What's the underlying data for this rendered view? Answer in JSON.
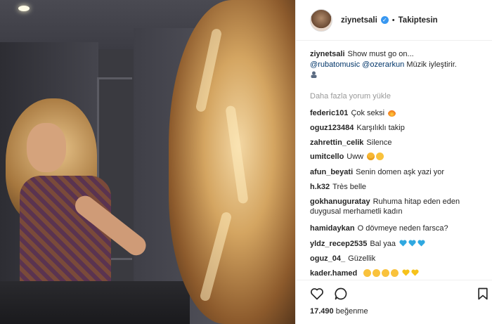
{
  "post": {
    "username": "ziynetsali",
    "verified_icon": "verified-badge-icon",
    "separator": "•",
    "follow_status": "Takiptesin"
  },
  "caption": {
    "username": "ziynetsali",
    "text": "Show must go on...",
    "mention_1": "@rubatomusic",
    "mention_2": "@ozerarkun",
    "text_2": "Müzik iyleştirir.",
    "emoji": "person-icon"
  },
  "load_more": "Daha fazla yorum yükle",
  "comments": [
    {
      "username": "federic101",
      "text": "Çok seksi",
      "emoji": "fire-icon"
    },
    {
      "username": "oguz123484",
      "text": "Karşılıklı takip"
    },
    {
      "username": "zahrettin_celik",
      "text": "Silence"
    },
    {
      "username": "umitcello",
      "text": "Uww",
      "emoji": "heart-eyes-icon, smile-icon"
    },
    {
      "username": "afun_beyati",
      "text": "Senin domen aşk yazi yor"
    },
    {
      "username": "h.k32",
      "text": "Très belle"
    },
    {
      "username": "gokhanuguratay",
      "text": "Ruhuma hitap eden eden duygusal merhametli kadın"
    },
    {
      "username": "hamidaykan",
      "text": "O dövmeye neden farsca?"
    },
    {
      "username": "yldz_recep2535",
      "text": "Bal yaa",
      "emoji": "blue-heart-icon x3"
    },
    {
      "username": "oguz_04_",
      "text": "Güzellik"
    },
    {
      "username": "kader.hamed",
      "text": "",
      "emoji": "smile-icon x4, yellow-heart-icon x2"
    }
  ],
  "actions": {
    "like_icon": "heart-outline-icon",
    "comment_icon": "comment-bubble-icon",
    "save_icon": "bookmark-icon"
  },
  "likes": {
    "count": "17.490",
    "label": "beğenme"
  },
  "colors": {
    "verified": "#3897f0",
    "mention": "#003569",
    "muted": "#999999",
    "text": "#262626"
  }
}
